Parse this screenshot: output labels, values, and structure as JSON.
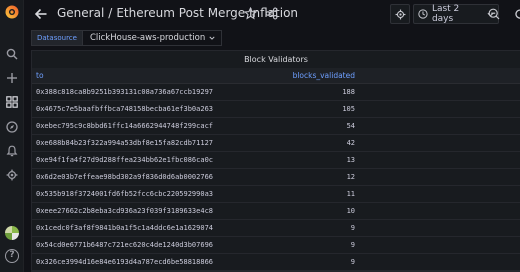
{
  "header": {
    "folder": "General",
    "separator": "/",
    "title": "Ethereum Post Merge Inflation"
  },
  "time_range": {
    "label": "Last 2 days"
  },
  "variable": {
    "label": "Datasource",
    "value": "ClickHouse-aws-production"
  },
  "panel": {
    "title": "Block Validators",
    "columns": [
      "to",
      "blocks_validated"
    ],
    "rows": [
      {
        "to": "0x388c818ca8b9251b393131c08a736a67ccb19297",
        "blocks_validated": "188"
      },
      {
        "to": "0x4675c7e5baafbffbca748158becba61ef3b0a263",
        "blocks_validated": "105"
      },
      {
        "to": "0xebec795c9c8bbd61ffc14a6662944748f299cacf",
        "blocks_validated": "54"
      },
      {
        "to": "0xe688b84b23f322a994a53dbf8e15fa82cdb71127",
        "blocks_validated": "42"
      },
      {
        "to": "0xe94f1fa4f27d9d288ffea234bb62e1fbc086ca0c",
        "blocks_validated": "13"
      },
      {
        "to": "0x6d2e03b7effeae98bd302a9f836d0d6ab0002766",
        "blocks_validated": "12"
      },
      {
        "to": "0x535b918f3724001fd6fb52fcc6cbc220592990a3",
        "blocks_validated": "11"
      },
      {
        "to": "0xeee27662c2b8eba3cd936a23f039f3189633e4c8",
        "blocks_validated": "10"
      },
      {
        "to": "0x1cedc0f3af8f9841b0a1f5c1a4ddc6e1a1629074",
        "blocks_validated": "9"
      },
      {
        "to": "0x54cd0e6771b6487c721ec620c4de1240d3b07696",
        "blocks_validated": "9"
      },
      {
        "to": "0x326ce3994d16e84e6193d4a787ecd6be58818866",
        "blocks_validated": "9"
      }
    ]
  },
  "icons": {
    "logo": "grafana-logo",
    "sidebar": [
      "search-icon",
      "plus-icon",
      "dashboards-icon",
      "explore-icon",
      "alerting-icon",
      "gear-icon"
    ]
  },
  "colors": {
    "accent": "#6e9fff",
    "background": "#111217",
    "panel": "#181b1f"
  }
}
